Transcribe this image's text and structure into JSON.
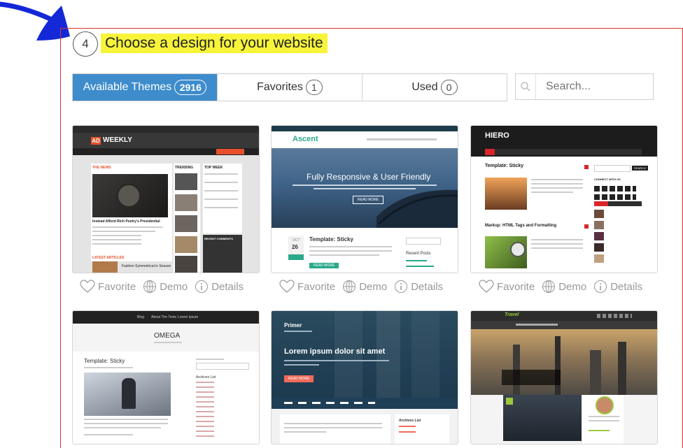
{
  "step": {
    "number": "4",
    "title": "Choose a design for your website"
  },
  "tabs": [
    {
      "label": "Available Themes",
      "count": "2916"
    },
    {
      "label": "Favorites",
      "count": "1"
    },
    {
      "label": "Used",
      "count": "0"
    }
  ],
  "search": {
    "placeholder": "Search..."
  },
  "actions": {
    "favorite": "Favorite",
    "demo": "Demo",
    "details": "Details"
  },
  "themes": {
    "weekly": {
      "logo_box": "AD",
      "logo": "WEEKLY",
      "sec1": "THE NEWS",
      "sec2": "TRENDING",
      "sec3": "TOP WEEK",
      "post": "Instead Afford Rich Poetry's Presidential",
      "latest": "LATEST ARTICLES",
      "fashion": "Fashion Symmetrical in Season",
      "comments": "RECENT COMMENTS"
    },
    "ascent": {
      "logo": "Ascent",
      "hero": "Fully Responsive & User Friendly",
      "btn": "READ MORE",
      "month": "OCT",
      "day": "26",
      "post_title": "Template: Sticky",
      "recent": "Recent Posts",
      "more": "READ MORE"
    },
    "hiero": {
      "logo": "HIERO",
      "post1": "Template: Sticky",
      "post2": "Markup: HTML Tags and Formatting",
      "connect": "CONNECT WITH US",
      "search_btn": "SEARCH"
    },
    "omega": {
      "nav1": "Blog",
      "nav2": "About The Tests",
      "nav3": "Lorem Ipsum",
      "logo": "OMEGA",
      "post_title": "Template: Sticky",
      "archives": "Archives List"
    },
    "primer": {
      "logo": "Primer",
      "headline": "Lorem ipsum dolor sit amet",
      "btn": "READ MORE",
      "archives": "Archives List"
    },
    "travel": {
      "logo": "Travel"
    }
  },
  "colors": {
    "accent": "#3e8ccc",
    "frame": "#d9302b",
    "highlight": "#f7f43a",
    "scribble": "#1428d8"
  }
}
